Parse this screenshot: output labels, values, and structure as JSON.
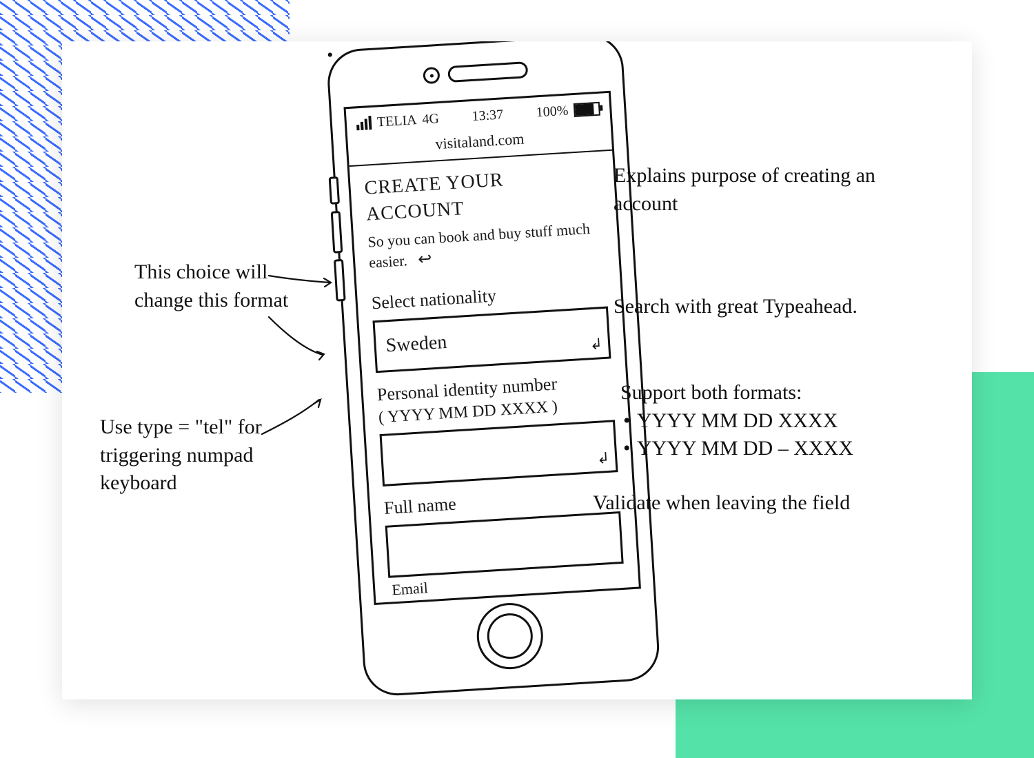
{
  "decor": {
    "hatch_color": "#3b6cff",
    "teal_color": "#54e2a8"
  },
  "phone": {
    "status": {
      "carrier": "TELIA",
      "network": "4G",
      "time": "13:37",
      "battery_pct": "100%"
    },
    "url": "visitaland.com",
    "form": {
      "title": "CREATE YOUR ACCOUNT",
      "subtitle": "So you can book and buy stuff much easier.",
      "nationality_label": "Select nationality",
      "nationality_value": "Sweden",
      "pin_label": "Personal identity number",
      "pin_hint": "( YYYY MM DD XXXX )",
      "pin_value": "",
      "name_label": "Full name",
      "name_value": "",
      "email_label_partial": "Email"
    }
  },
  "annotations": {
    "explains": "Explains purpose of creating an account",
    "typeahead": "Search with great Typeahead.",
    "formats_intro": "Support both formats:",
    "format1": "YYYY MM DD XXXX",
    "format2": "YYYY MM DD – XXXX",
    "validate": "Validate when leaving the field",
    "choice": "This choice will change this format",
    "tel": "Use type = \"tel\" for triggering numpad keyboard"
  }
}
